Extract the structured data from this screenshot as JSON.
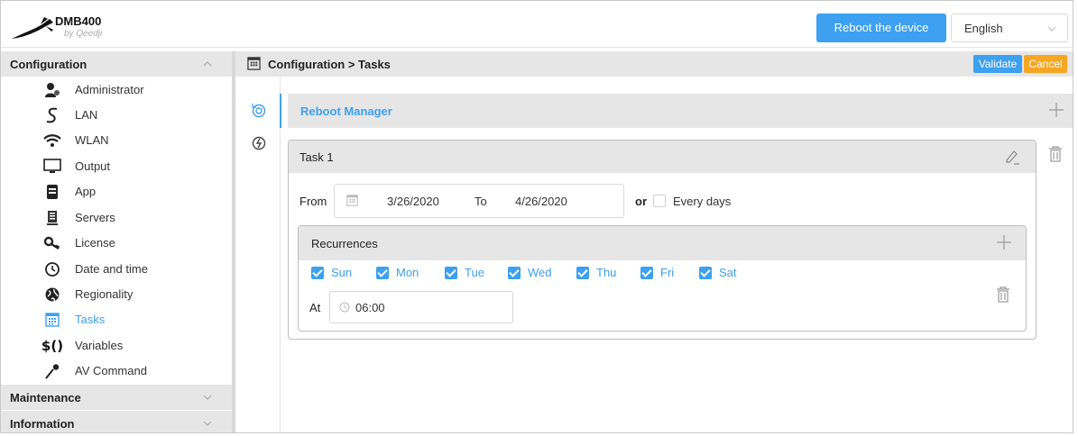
{
  "app": {
    "title": "DMB400",
    "subtitle": "by Qeedji"
  },
  "header": {
    "reboot_label": "Reboot the device",
    "language": "English"
  },
  "sidebar": {
    "configuration_label": "Configuration",
    "items": [
      {
        "label": "Administrator",
        "icon": "administrator-icon"
      },
      {
        "label": "LAN",
        "icon": "lan-icon"
      },
      {
        "label": "WLAN",
        "icon": "wifi-icon"
      },
      {
        "label": "Output",
        "icon": "monitor-icon"
      },
      {
        "label": "App",
        "icon": "app-icon"
      },
      {
        "label": "Servers",
        "icon": "server-icon"
      },
      {
        "label": "License",
        "icon": "key-icon"
      },
      {
        "label": "Date and time",
        "icon": "clock-icon"
      },
      {
        "label": "Regionality",
        "icon": "globe-icon"
      },
      {
        "label": "Tasks",
        "icon": "calendar-icon",
        "active": true
      },
      {
        "label": "Variables",
        "icon": "variables-icon",
        "glyph": "$()"
      },
      {
        "label": "AV Command",
        "icon": "microphone-icon"
      }
    ],
    "maintenance_label": "Maintenance",
    "information_label": "Information"
  },
  "content": {
    "breadcrumb": "Configuration > Tasks",
    "validate_label": "Validate",
    "cancel_label": "Cancel",
    "section_title": "Reboot Manager",
    "task": {
      "title": "Task 1",
      "from_label": "From",
      "from_date": "3/26/2020",
      "to_label": "To",
      "to_date": "4/26/2020",
      "or_label": "or",
      "every_days_label": "Every days",
      "every_days_checked": false,
      "recurrences": {
        "title": "Recurrences",
        "days": [
          {
            "label": "Sun",
            "checked": true
          },
          {
            "label": "Mon",
            "checked": true
          },
          {
            "label": "Tue",
            "checked": true
          },
          {
            "label": "Wed",
            "checked": true
          },
          {
            "label": "Thu",
            "checked": true
          },
          {
            "label": "Fri",
            "checked": true
          },
          {
            "label": "Sat",
            "checked": true
          }
        ],
        "at_label": "At",
        "time": "06:00"
      }
    }
  },
  "colors": {
    "accent": "#3da0f0",
    "cancel": "#f5a623",
    "bar": "#e6e6e6"
  }
}
